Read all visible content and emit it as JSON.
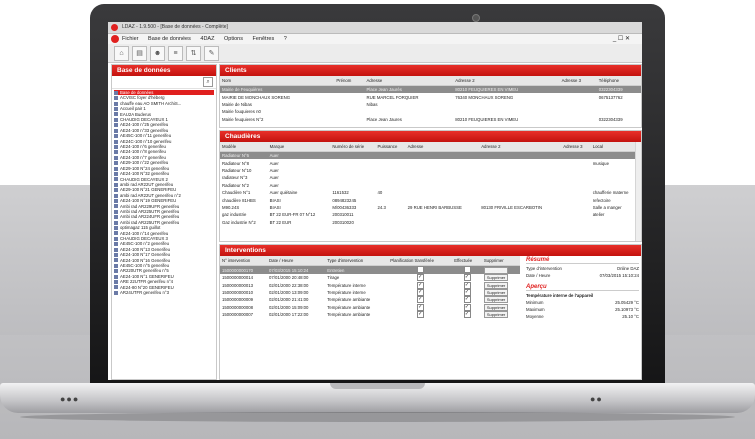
{
  "app": {
    "title": "LDAZ - 1.9.500 - [Base de données - Complète]",
    "menu": [
      "Fichier",
      "Base de données",
      "4DAZ",
      "Options",
      "Fenêtres",
      "?"
    ],
    "window_controls": "_ ☐ ✕"
  },
  "left_panel": {
    "title": "Base de données",
    "tree": [
      {
        "label": "Base de données",
        "selected": true
      },
      {
        "label": "ACVISC foyer d'héberg"
      },
      {
        "label": "chauffe eau AO SMITH ArchiS..."
      },
      {
        "label": "Accueil pair 1"
      },
      {
        "label": "EAU2A Buderus"
      },
      {
        "label": "CHAUDIG DECAYEUX 1"
      },
      {
        "label": "AE24-100    n°25 generifeu"
      },
      {
        "label": "AE24-100    n°33 generifeu"
      },
      {
        "label": "AE45C-100   n°11 generifeu"
      },
      {
        "label": "AE24C-100   n°10 generifeu"
      },
      {
        "label": "AE24-100    n°6 generifeu"
      },
      {
        "label": "AE24-100    n°8 generifeu"
      },
      {
        "label": "AE24-100    n°7 generifeu"
      },
      {
        "label": "AE29-100    n°22 generifeu"
      },
      {
        "label": "AE29-100   N°24 generifeu"
      },
      {
        "label": "AE24-100   N°32 generifeu"
      },
      {
        "label": "CHAUDIG DECAYEUX 2"
      },
      {
        "label": "ambi rad AR22UT generifeu"
      },
      {
        "label": "AE29-100   N°21 GENERIFEU"
      },
      {
        "label": "ambi rad AR22UT generifeu n°2"
      },
      {
        "label": "AE24-100    N°19 GENERIFEU"
      },
      {
        "label": "Ambi rad AR229UFR generifeu"
      },
      {
        "label": "Ambi rad AR225UTR generifeu"
      },
      {
        "label": "Ambi rad AR224UFR generifeu"
      },
      {
        "label": "Ambi rad AR225UTR generifeu"
      },
      {
        "label": "optimagaz  115 guillot"
      },
      {
        "label": "AE24-100    n°14 generifeu"
      },
      {
        "label": "CHAUDIG DECAYEUX 3"
      },
      {
        "label": "AE45C-100   n°2 generifeu"
      },
      {
        "label": "AE24-100 N°13 Generifeu"
      },
      {
        "label": "AE24-100   N°17 Generifeu"
      },
      {
        "label": "AE24-100   N°16 Generifeu"
      },
      {
        "label": "AE45C-100   n°5 generifeu"
      },
      {
        "label": "AR220UTR generifeu  n°5"
      },
      {
        "label": "AE24-100 N°1 GENERIFEU"
      },
      {
        "label": "ARE 22UTFR generifeu  n°4"
      },
      {
        "label": "AE24-80    N°20 GENERIFEU"
      },
      {
        "label": "AR24UTFR generifeu  n°3"
      }
    ]
  },
  "clients": {
    "title": "Clients",
    "columns": [
      "Nom",
      "Prénom",
      "Adresse",
      "Adresse 2",
      "Adresse 3",
      "Téléphone"
    ],
    "rows": [
      [
        "Mairie de Feuquières",
        "",
        "Place Jean Jaurès",
        "80210 FEUQUIERES EN VIMEU",
        "",
        "0322304339"
      ],
      [
        "MAIRIE DE MONCHAUX SORENG",
        "",
        "RUE MARCEL FORQUIER",
        "76340 MONCHAUX SORENG",
        "",
        "0675137762"
      ],
      [
        "Mairie de Nibas",
        "",
        "Nibas",
        "",
        "",
        ""
      ],
      [
        "Mairie fouquieres n0",
        "",
        "",
        "",
        "",
        ""
      ],
      [
        "Mairie feuquieres N°2",
        "",
        "Place Jean Jaures",
        "80210 FEUQUIERES EN VIMEU",
        "",
        "0322304339"
      ]
    ]
  },
  "chaudieres": {
    "title": "Chaudières",
    "columns": [
      "Modèle",
      "Marque",
      "Numéro de série",
      "Puissance",
      "Adresse",
      "Adresse 2",
      "Adresse 3",
      "Local"
    ],
    "rows": [
      [
        "Radiateur N°6",
        "Auer",
        "",
        "",
        "",
        "",
        "",
        ""
      ],
      [
        "Radiateur N°8",
        "Auer",
        "",
        "",
        "",
        "",
        "",
        "musique"
      ],
      [
        "Radiateur N°10",
        "Auer",
        "",
        "",
        "",
        "",
        "",
        ""
      ],
      [
        "radiateur N°3",
        "Auer",
        "",
        "",
        "",
        "",
        "",
        ""
      ],
      [
        "Radiateur N°2",
        "Auer",
        "",
        "",
        "",
        "",
        "",
        ""
      ],
      [
        "Chaudière N°1",
        "Auer quiétaine",
        "1161532",
        "40",
        "",
        "",
        "",
        "chaufferie materne"
      ],
      [
        "chaudière 81HBS",
        "BIASI",
        "0894823245",
        "",
        "",
        "",
        "",
        "refectoire"
      ],
      [
        "M90.24S",
        "BIASI",
        "M/00436333",
        "24.3",
        "29 RUE HENRI BARBUSSE",
        "80130 FRIVILLE ESCARBOTIN",
        "",
        "Salle a manger"
      ],
      [
        "gaz industrie",
        "BT 22 EUR-FR 07 N°12",
        "200310011",
        "",
        "",
        "",
        "",
        "atelier"
      ],
      [
        "Gaz industrie  N°2",
        "BT 22 EUR",
        "200310020",
        "",
        "",
        "",
        "",
        ""
      ]
    ]
  },
  "interventions": {
    "title": "Interventions",
    "columns": [
      "N° intervention",
      "Date / Heure",
      "Type d'intervention",
      "Planification transférée",
      "Effectuée",
      "Supprimer"
    ],
    "rows": [
      {
        "num": "1500000000170",
        "date": "07/03/2015 15:10:24",
        "type": "Entretien",
        "plan": false,
        "eff": false,
        "btn": "Supprimer",
        "selected": true
      },
      {
        "num": "1500000000014",
        "date": "07/01/2000 20:48:00",
        "type": "Tirage",
        "plan": true,
        "eff": true,
        "btn": "Supprimer"
      },
      {
        "num": "1500000000013",
        "date": "02/01/2000 22:38:00",
        "type": "Température interne",
        "plan": true,
        "eff": true,
        "btn": "Supprimer"
      },
      {
        "num": "1500000000010",
        "date": "02/01/2000 13:09:00",
        "type": "Température interne",
        "plan": true,
        "eff": true,
        "btn": "Supprimer"
      },
      {
        "num": "1500000000009",
        "date": "02/01/2000 21:41:00",
        "type": "Température ambiante",
        "plan": true,
        "eff": true,
        "btn": "Supprimer"
      },
      {
        "num": "1500000000008",
        "date": "02/01/2000 15:09:00",
        "type": "Température ambiante",
        "plan": true,
        "eff": true,
        "btn": "Supprimer"
      },
      {
        "num": "1500000000007",
        "date": "02/01/2000 17:22:00",
        "type": "Température ambiante",
        "plan": true,
        "eff": true,
        "btn": "Supprimer"
      }
    ],
    "resume": {
      "title": "Résumé",
      "type_label": "Type d'intervention",
      "type_value": "Online DAZ",
      "date_label": "Date / Heure",
      "date_value": "07/03/2015 15:10:24",
      "apercu_title": "Aperçu",
      "apercu_sub": "Température interne de l'appareil",
      "min_label": "Minimum",
      "min_value": "25.05429 °C",
      "max_label": "Maximum",
      "max_value": "25.10973 °C",
      "avg_label": "Moyenne",
      "avg_value": "25.10 °C"
    }
  }
}
